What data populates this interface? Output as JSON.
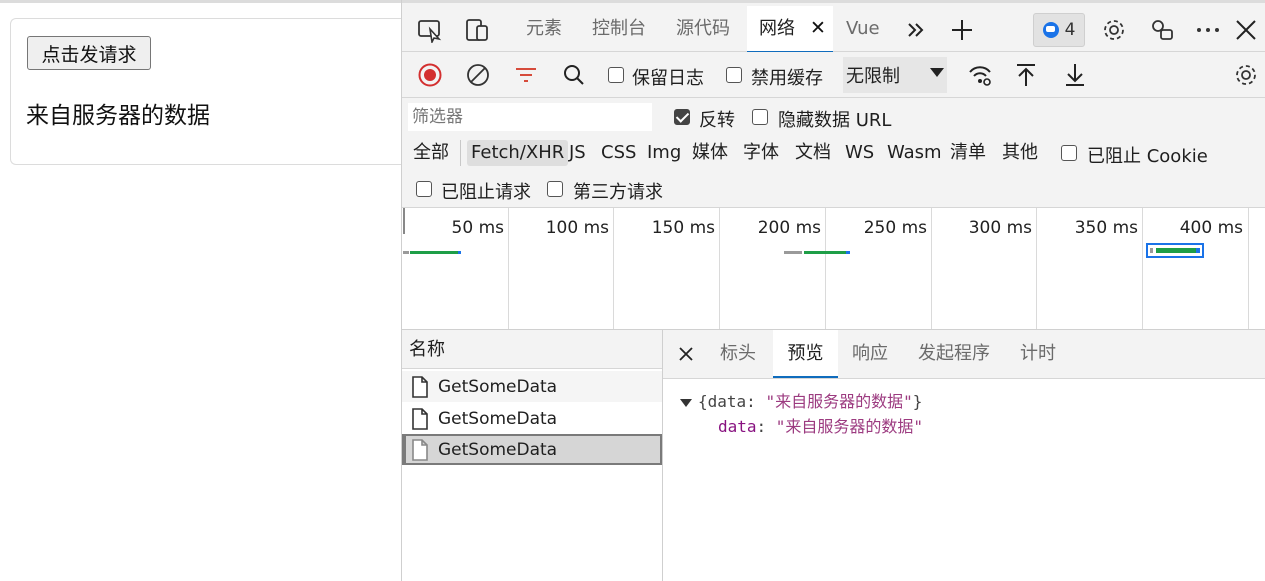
{
  "page": {
    "request_button_label": "点击发请求",
    "server_text": "来自服务器的数据"
  },
  "devtools": {
    "tabs": [
      "元素",
      "控制台",
      "源代码",
      "网络",
      "Vue"
    ],
    "active_tab": "网络",
    "issues_count": "4",
    "toolbar": {
      "preserve_log": "保留日志",
      "disable_cache": "禁用缓存",
      "throttle": "无限制"
    },
    "filter": {
      "placeholder": "筛选器",
      "invert": "反转",
      "hide_data_urls": "隐藏数据 URL"
    },
    "types": [
      "全部",
      "Fetch/XHR",
      "JS",
      "CSS",
      "Img",
      "媒体",
      "字体",
      "文档",
      "WS",
      "Wasm",
      "清单",
      "其他"
    ],
    "active_type": "Fetch/XHR",
    "blocked_cookies": "已阻止 Cookie",
    "blocked_requests": "已阻止请求",
    "third_party": "第三方请求",
    "timeline_ticks": [
      "50 ms",
      "100 ms",
      "150 ms",
      "200 ms",
      "250 ms",
      "300 ms",
      "350 ms",
      "400 ms"
    ],
    "requests": {
      "header": "名称",
      "items": [
        "GetSomeData",
        "GetSomeData",
        "GetSomeData"
      ],
      "selected_index": 2
    },
    "detail": {
      "tabs": [
        "标头",
        "预览",
        "响应",
        "发起程序",
        "计时"
      ],
      "active_tab": "预览",
      "preview_summary_open": "{data: ",
      "preview_summary_value": "\"来自服务器的数据\"",
      "preview_summary_close": "}",
      "preview_key": "data",
      "preview_value": "\"来自服务器的数据\""
    }
  },
  "colors": {
    "accent": "#0f6cbd",
    "record_red": "#d32f2f",
    "bar_green": "#1e9e47",
    "bar_blue": "#1a73e8"
  }
}
